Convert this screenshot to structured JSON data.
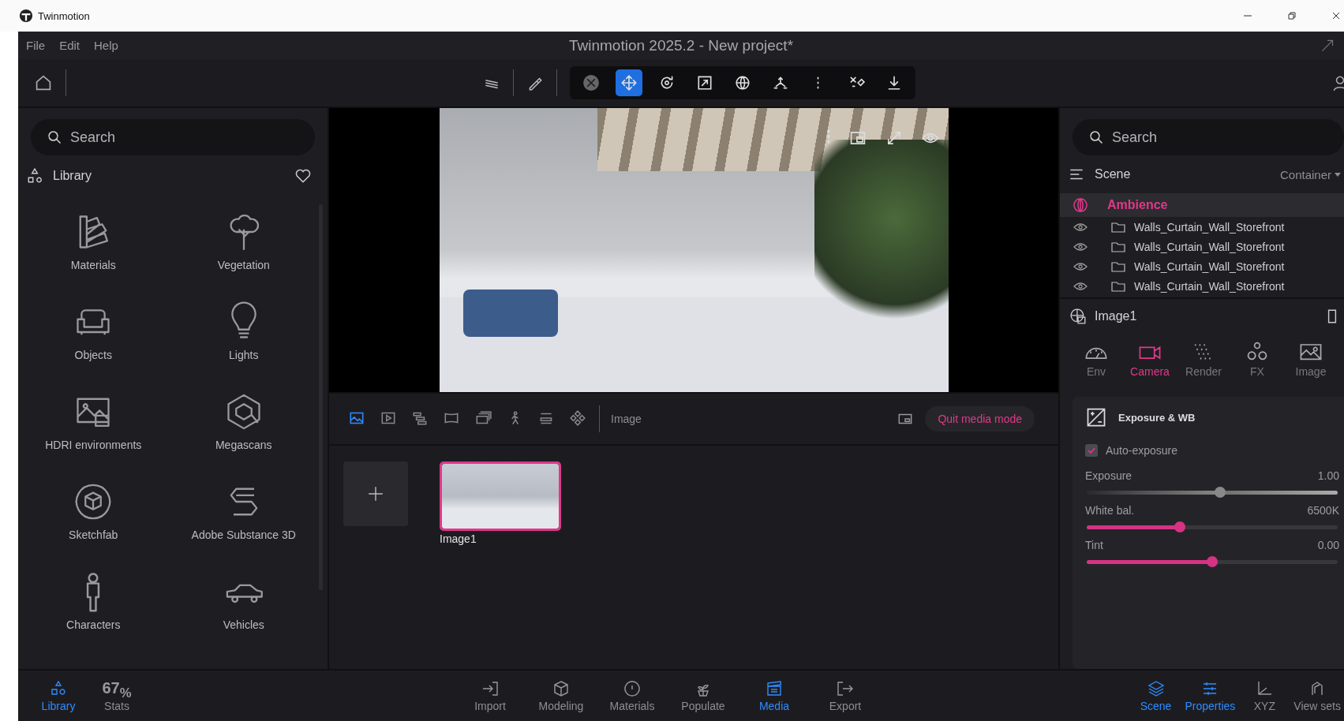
{
  "window": {
    "app_name": "Twinmotion",
    "title": "Twinmotion 2025.2 - New project*"
  },
  "menu": [
    "File",
    "Edit",
    "Help"
  ],
  "toolbar": {
    "tools": [
      {
        "selected": false
      },
      {
        "selected": true
      },
      {
        "selected": false
      },
      {
        "selected": false
      },
      {
        "selected": false
      },
      {
        "selected": false
      },
      {
        "selected": false
      },
      {
        "selected": false
      },
      {
        "selected": false
      }
    ]
  },
  "library": {
    "search": {
      "placeholder": "Search"
    },
    "title": "Library",
    "items": [
      {
        "label": "Materials"
      },
      {
        "label": "Vegetation"
      },
      {
        "label": "Objects"
      },
      {
        "label": "Lights"
      },
      {
        "label": "HDRI environments"
      },
      {
        "label": "Megascans"
      },
      {
        "label": "Sketchfab"
      },
      {
        "label": "Adobe Substance 3D"
      },
      {
        "label": "Characters"
      },
      {
        "label": "Vehicles"
      }
    ]
  },
  "media": {
    "tabs": [
      {
        "selected": true
      },
      {
        "selected": false
      },
      {
        "selected": false
      },
      {
        "selected": false
      },
      {
        "selected": false
      },
      {
        "selected": false
      },
      {
        "selected": false
      },
      {
        "selected": false
      }
    ],
    "section": "Image",
    "quit_button": "Quit media mode",
    "items": [
      {
        "label": "Image1",
        "selected": true
      }
    ]
  },
  "scene": {
    "search": {
      "placeholder": "Search"
    },
    "title": "Scene",
    "filter": "Container",
    "items": [
      {
        "label": "Ambience",
        "selected": true,
        "kind": "ambience"
      },
      {
        "label": "Walls_Curtain_Wall_Storefront",
        "selected": false,
        "kind": "folder"
      },
      {
        "label": "Walls_Curtain_Wall_Storefront",
        "selected": false,
        "kind": "folder"
      },
      {
        "label": "Walls_Curtain_Wall_Storefront",
        "selected": false,
        "kind": "folder"
      },
      {
        "label": "Walls_Curtain_Wall_Storefront",
        "selected": false,
        "kind": "folder"
      }
    ]
  },
  "properties": {
    "title": "Image1",
    "tabs": [
      {
        "label": "Env",
        "selected": false
      },
      {
        "label": "Camera",
        "selected": true
      },
      {
        "label": "Render",
        "selected": false
      },
      {
        "label": "FX",
        "selected": false
      },
      {
        "label": "Image",
        "selected": false
      }
    ],
    "section": {
      "title": "Exposure & WB",
      "checkbox": {
        "label": "Auto-exposure",
        "checked": true
      },
      "sliders": [
        {
          "label": "Exposure",
          "reading": "1.00",
          "level": 0.53,
          "kind": "neutral"
        },
        {
          "label": "White bal.",
          "reading": "6500K",
          "level": 0.37,
          "kind": "accent"
        },
        {
          "label": "Tint",
          "reading": "0.00",
          "level": 0.5,
          "kind": "accent"
        }
      ]
    }
  },
  "bottom_bar": {
    "left": [
      {
        "label": "Library",
        "selected": true,
        "kind": "icon"
      },
      {
        "label": "Stats",
        "value": "67$_{%}$",
        "selected": false,
        "kind": "stat"
      }
    ],
    "center": [
      {
        "label": "Import",
        "selected": false
      },
      {
        "label": "Modeling",
        "selected": false
      },
      {
        "label": "Materials",
        "selected": false
      },
      {
        "label": "Populate",
        "selected": false
      },
      {
        "label": "Media",
        "selected": true
      },
      {
        "label": "Export",
        "selected": false
      }
    ],
    "right": [
      {
        "label": "Scene",
        "selected": true
      },
      {
        "label": "Properties",
        "selected": true
      },
      {
        "label": "XYZ",
        "selected": false
      },
      {
        "label": "View sets",
        "selected": false
      }
    ]
  }
}
